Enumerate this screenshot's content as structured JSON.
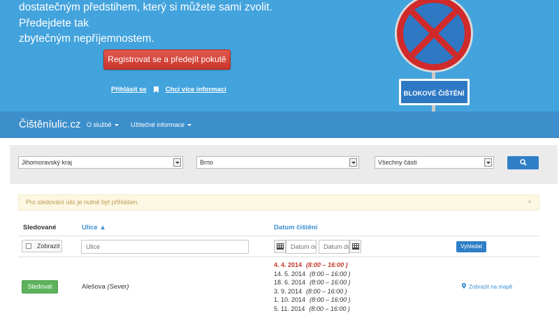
{
  "hero": {
    "line1": "dostatečným předstihem, který si můžete sami zvolit. Předejdete tak",
    "line2": "zbytečným nepříjemnostem.",
    "register_button": "Registrovat se a předejít pokutě",
    "login_link": "Přihlásit se",
    "more_info_link": "Chci více informací",
    "sign_text": "BLOKOVÉ ČIŠTĚNÍ"
  },
  "navbar": {
    "brand": "Čištěníulic.cz",
    "items": [
      {
        "label": "O službě"
      },
      {
        "label": "Užitečné informace"
      }
    ]
  },
  "filters": {
    "region": "Jihomoravský kraj",
    "city": "Brno",
    "district": "Všechny části"
  },
  "alert": {
    "text": "Pro sledování ulic je nutné být přihlášen.",
    "close": "×"
  },
  "table": {
    "headers": {
      "followed": "Sledované",
      "street": "Ulice ▲",
      "date": "Datum čištění"
    },
    "filter_row": {
      "show_label": "Zobrazit",
      "street_placeholder": "Ulice",
      "date_from_placeholder": "Datum od",
      "date_to_placeholder": "Datum do",
      "search_label": "Vyhledat"
    },
    "rows": [
      {
        "follow_label": "Sledovat",
        "street": "Alešova",
        "street_part": "(Sever)",
        "dates": [
          {
            "date": "4. 4. 2014",
            "time": "(8:00 – 16:00 )"
          },
          {
            "date": "14. 5. 2014",
            "time": "(8:00 – 16:00 )"
          },
          {
            "date": "18. 6. 2014",
            "time": "(8:00 – 16:00 )"
          },
          {
            "date": "3. 9. 2014",
            "time": "(8:00 – 16:00 )"
          },
          {
            "date": "1. 10. 2014",
            "time": "(8:00 – 16:00 )"
          },
          {
            "date": "5. 11. 2014",
            "time": "(8:00 – 16:00 )"
          }
        ],
        "map_link": "Zobrazit na mapě"
      }
    ]
  },
  "colors": {
    "hero_bg": "#43a3dd",
    "navbar_bg": "#3d8fcb",
    "register_red": "#d8443a",
    "link_blue": "#3b8fd1",
    "follow_green": "#5cb35c",
    "alert_bg": "#fcf8e3",
    "date_highlight": "#c0392b"
  },
  "icons": {
    "bookmark": "bookmark-icon",
    "search": "search-icon",
    "calendar": "calendar-icon",
    "checkbox": "checkbox-icon",
    "map_pin": "map-marker-icon",
    "sign": "no-stopping-sign-icon"
  }
}
